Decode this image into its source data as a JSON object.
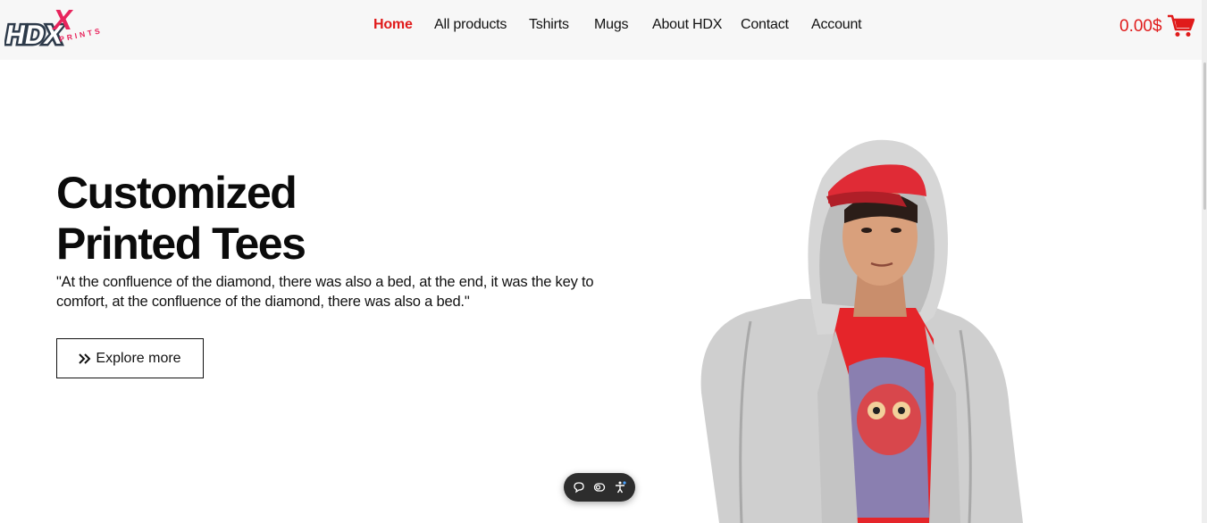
{
  "brand": {
    "logo_main": "HDX",
    "logo_x": "X",
    "logo_sub": "PRINTS",
    "accent": "#e01b1b"
  },
  "nav": {
    "items": [
      {
        "label": "Home",
        "active": true
      },
      {
        "label": "All products"
      },
      {
        "label": "Tshirts"
      },
      {
        "label": "Mugs"
      },
      {
        "label": "About HDX"
      },
      {
        "label": "Contact"
      },
      {
        "label": "Account"
      }
    ]
  },
  "cart": {
    "total": "0.00$",
    "icon": "shopping-cart-icon"
  },
  "hero": {
    "title_line1": "Customized",
    "title_line2": "Printed Tees",
    "quote": "\"At the confluence of the diamond, there was also a bed, at the end, it was the key to comfort, at the confluence of the diamond, there was also a bed.\"",
    "button_label": "Explore more",
    "button_icon": "double-chevron-right-icon",
    "image": "model-in-grey-hoodie-red-cap"
  },
  "widget": {
    "icons": [
      "chat-icon",
      "cookie-icon",
      "accessibility-icon"
    ]
  }
}
